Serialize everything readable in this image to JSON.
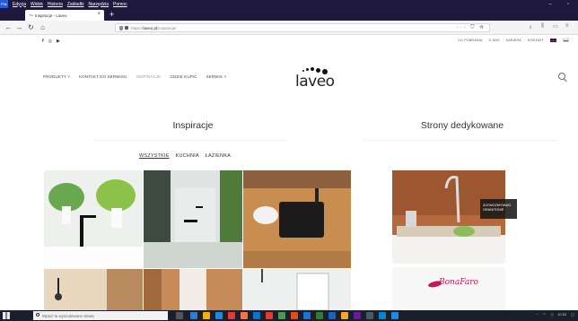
{
  "menubar": {
    "items": [
      "Plik",
      "Edycja",
      "Widok",
      "Historia",
      "Zakładki",
      "Narzędzia",
      "Pomoc"
    ]
  },
  "tab": {
    "title": "Inspiracje - Laveo"
  },
  "urlbar": {
    "url_prefix": "https://",
    "url_domain": "laveo.pl",
    "url_path": "/inspiracje/"
  },
  "site_top": {
    "links": [
      "DO POBRANIA",
      "O NAS",
      "KARIERA",
      "KONTAKT"
    ]
  },
  "main_nav": {
    "items": [
      {
        "label": "PRODUKTY",
        "dropdown": true
      },
      {
        "label": "KONTAKT DO SERWISU",
        "dropdown": false
      },
      {
        "label": "INSPIRACJE",
        "dropdown": false,
        "active": true
      },
      {
        "label": "GDZIE KUPIĆ",
        "dropdown": false
      },
      {
        "label": "SERWIS",
        "dropdown": true
      }
    ],
    "logo_text": "laveo"
  },
  "inspiracje": {
    "title": "Inspiracje",
    "filters": [
      "WSZYSTKIE",
      "KUCHNIA",
      "ŁAZIENKA"
    ],
    "current_filter": "WSZYSTKIE"
  },
  "dedykowane": {
    "title": "Strony dedykowane",
    "badge_line1": "ZLEWOZMYWAKI",
    "badge_line2": "GRANITOWE",
    "brand_logo": "BonaFaro"
  },
  "taskbar": {
    "search_placeholder": "Wpisz tu wyszukiwane słowa",
    "clock": "10:53"
  },
  "colors": {
    "chrome_dark": "#1f1a3d",
    "accent_blue": "#2a5bd7",
    "brand_pink": "#c2185b"
  }
}
